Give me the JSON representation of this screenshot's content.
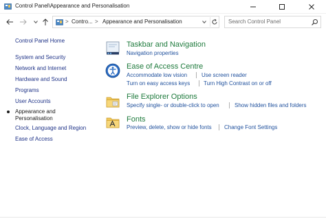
{
  "window": {
    "title": "Control Panel\\Appearance and Personalisation"
  },
  "address": {
    "segments": [
      "Contro...",
      "Appearance and Personalisation"
    ],
    "separator": ">"
  },
  "search": {
    "placeholder": "Search Control Panel"
  },
  "sidebar": {
    "items": [
      {
        "label": "Control Panel Home"
      },
      {
        "label": "System and Security"
      },
      {
        "label": "Network and Internet"
      },
      {
        "label": "Hardware and Sound"
      },
      {
        "label": "Programs"
      },
      {
        "label": "User Accounts"
      },
      {
        "label_line1": "Appearance and",
        "label_line2": "Personalisation",
        "current": true
      },
      {
        "label": "Clock, Language and Region"
      },
      {
        "label": "Ease of Access"
      }
    ]
  },
  "categories": [
    {
      "title": "Taskbar and Navigation",
      "icon": "taskbar-icon",
      "links": [
        "Navigation properties"
      ]
    },
    {
      "title": "Ease of Access Centre",
      "icon": "ease-of-access-icon",
      "links": [
        "Accommodate low vision",
        "Use screen reader",
        "Turn on easy access keys",
        "Turn High Contrast on or off"
      ]
    },
    {
      "title": "File Explorer Options",
      "icon": "folder-options-icon",
      "links": [
        "Specify single- or double-click to open",
        "Show hidden files and folders"
      ]
    },
    {
      "title": "Fonts",
      "icon": "fonts-folder-icon",
      "links": [
        "Preview, delete, show or hide fonts",
        "Change Font Settings"
      ]
    }
  ],
  "colors": {
    "category_title": "#1e7a3c",
    "link": "#1e4f9c",
    "sidebar_link": "#1e3287"
  }
}
